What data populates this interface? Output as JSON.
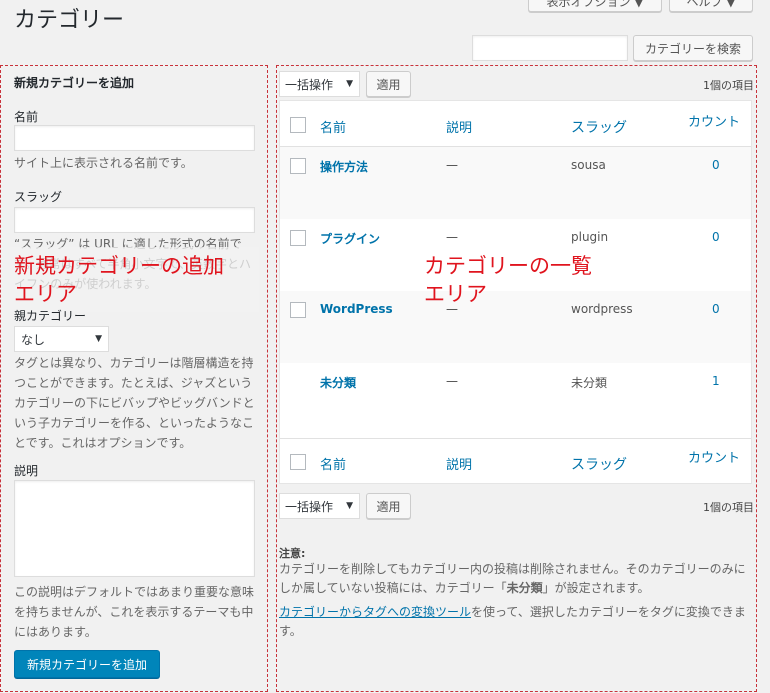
{
  "header": {
    "title": "カテゴリー",
    "screen_options": "表示オプション ▼",
    "help": "ヘルプ ▼",
    "search_button": "カテゴリーを検索",
    "search_value": ""
  },
  "add_form": {
    "heading": "新規カテゴリーを追加",
    "name_label": "名前",
    "name_value": "",
    "name_desc": "サイト上に表示される名前です。",
    "slug_label": "スラッグ",
    "slug_value": "",
    "slug_desc": "“スラッグ” は URL に適した形式の名前です。通常はすべて半角小文字で、英数字とハイフンのみが使われます。",
    "parent_label": "親カテゴリー",
    "parent_value": "なし",
    "parent_desc": "タグとは異なり、カテゴリーは階層構造を持つことができます。たとえば、ジャズというカテゴリーの下にビバップやビッグバンドという子カテゴリーを作る、といったようなことです。これはオプションです。",
    "desc_label": "説明",
    "desc_value": "",
    "desc_desc": "この説明はデフォルトではあまり重要な意味を持ちませんが、これを表示するテーマも中にはあります。",
    "submit": "新規カテゴリーを追加"
  },
  "annotations": {
    "left": "新規カテゴリーの追加エリア",
    "left_l1": "新規カテゴリーの追加",
    "left_l2": "エリア",
    "right_l1": "カテゴリーの一覧",
    "right_l2": "エリア",
    "color": "#e0141e"
  },
  "list": {
    "bulk_action": "一括操作",
    "apply": "適用",
    "count_text": "1個の項目",
    "columns": {
      "name": "名前",
      "description": "説明",
      "slug": "スラッグ",
      "count": "カウント"
    },
    "rows": [
      {
        "name": "操作方法",
        "description": "—",
        "slug": "sousa",
        "count": "0",
        "checkbox": true
      },
      {
        "name": "プラグイン",
        "description": "—",
        "slug": "plugin",
        "count": "0",
        "checkbox": true
      },
      {
        "name": "WordPress",
        "description": "—",
        "slug": "wordpress",
        "count": "0",
        "checkbox": true
      },
      {
        "name": "未分類",
        "description": "—",
        "slug": "未分類",
        "count": "1",
        "checkbox": false
      }
    ]
  },
  "note": {
    "title": "注意:",
    "text1": "カテゴリーを削除してもカテゴリー内の投稿は削除されません。そのカテゴリーのみにしか属していない投稿には、カテゴリー「",
    "bold": "未分類",
    "text2": "」が設定されます。",
    "link": "カテゴリーからタグへの変換ツール",
    "text3": "を使って、選択したカテゴリーをタグに変換できます。"
  },
  "colors": {
    "accent": "#0073aa",
    "primary_button": "#0085ba",
    "dashed_border": "#c8323a"
  }
}
